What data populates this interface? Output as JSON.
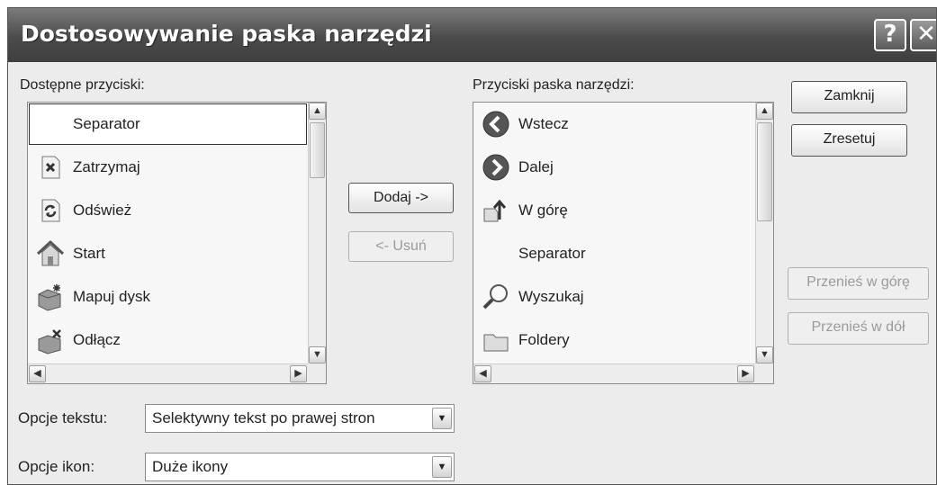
{
  "dialog": {
    "title": "Dostosowywanie paska narzędzi",
    "help_label": "?",
    "close_label": "✕"
  },
  "available": {
    "label": "Dostępne przyciski:",
    "items": [
      {
        "label": "Separator",
        "icon": "none"
      },
      {
        "label": "Zatrzymaj",
        "icon": "stop-icon"
      },
      {
        "label": "Odśwież",
        "icon": "refresh-icon"
      },
      {
        "label": "Start",
        "icon": "home-icon"
      },
      {
        "label": "Mapuj dysk",
        "icon": "map-drive-icon"
      },
      {
        "label": "Odłącz",
        "icon": "disconnect-drive-icon"
      }
    ]
  },
  "current": {
    "label": "Przyciski paska narzędzi:",
    "items": [
      {
        "label": "Wstecz",
        "icon": "back-icon"
      },
      {
        "label": "Dalej",
        "icon": "forward-icon"
      },
      {
        "label": "W górę",
        "icon": "up-folder-icon"
      },
      {
        "label": "Separator",
        "icon": "none"
      },
      {
        "label": "Wyszukaj",
        "icon": "search-icon"
      },
      {
        "label": "Foldery",
        "icon": "folders-icon"
      }
    ]
  },
  "buttons": {
    "add": "Dodaj ->",
    "remove": "<- Usuń",
    "close": "Zamknij",
    "reset": "Zresetuj",
    "move_up": "Przenieś w górę",
    "move_down": "Przenieś w dół"
  },
  "text_options": {
    "label": "Opcje tekstu:",
    "value": "Selektywny tekst po prawej stron"
  },
  "icon_options": {
    "label": "Opcje ikon:",
    "value": "Duże ikony"
  },
  "scroll_glyphs": {
    "up": "▲",
    "down": "▼",
    "left": "◀",
    "right": "▶"
  }
}
